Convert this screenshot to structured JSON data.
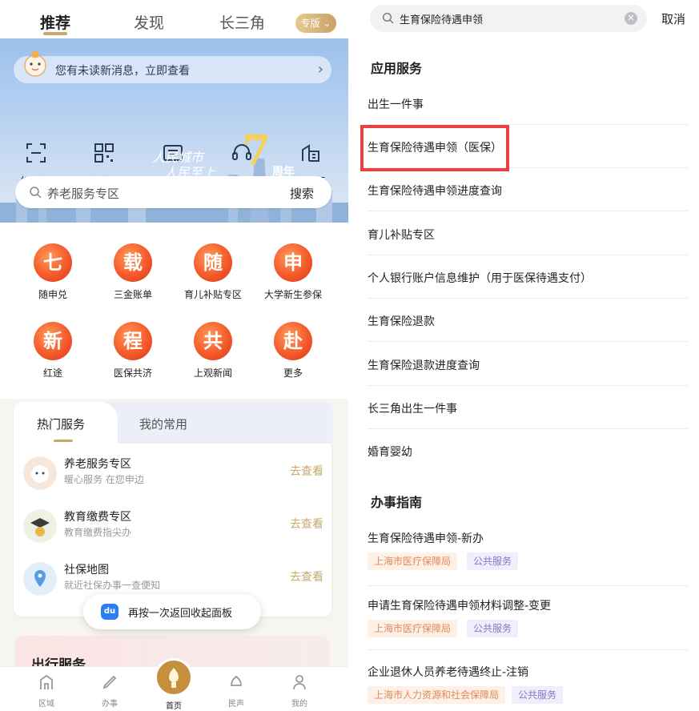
{
  "left": {
    "top_tabs": [
      {
        "label": "推荐",
        "active": true
      },
      {
        "label": "发现",
        "active": false
      },
      {
        "label": "长三角",
        "active": false
      }
    ],
    "edition_label": "专版",
    "notice": {
      "text": "您有未读新消息，立即查看"
    },
    "quick_actions": [
      {
        "label": "扫一扫",
        "icon": "scan-icon"
      },
      {
        "label": "随申码",
        "icon": "qr-code-icon"
      },
      {
        "label": "亮证",
        "icon": "id-card-icon"
      },
      {
        "label": "客服",
        "icon": "customer-service-icon"
      },
      {
        "label": "企业云",
        "icon": "enterprise-cloud-icon"
      }
    ],
    "slogan": [
      "人民城市",
      "人民至上"
    ],
    "anniversary": {
      "digit": "7",
      "label": "周年"
    },
    "search": {
      "placeholder": "养老服务专区",
      "button": "搜索"
    },
    "grid": [
      {
        "char": "七",
        "label": "随申兑"
      },
      {
        "char": "载",
        "label": "三金账单"
      },
      {
        "char": "随",
        "label": "育儿补贴专区"
      },
      {
        "char": "申",
        "label": "大学新生参保"
      },
      {
        "char": "新",
        "label": "红途"
      },
      {
        "char": "程",
        "label": "医保共济"
      },
      {
        "char": "共",
        "label": "上观新闻"
      },
      {
        "char": "赴",
        "label": "更多"
      }
    ],
    "services_card": {
      "tabs": [
        {
          "label": "热门服务",
          "active": true
        },
        {
          "label": "我的常用",
          "active": false
        }
      ],
      "rows": [
        {
          "title": "养老服务专区",
          "subtitle": "暖心服务 在您申边",
          "link": "去查看"
        },
        {
          "title": "教育缴费专区",
          "subtitle": "教育缴费指尖办",
          "link": "去查看"
        },
        {
          "title": "社保地图",
          "subtitle": "就近社保办事一查便知",
          "link": "去查看"
        }
      ]
    },
    "toast": {
      "logo": "du",
      "text": "再按一次返回收起面板"
    },
    "travel_title": "出行服务",
    "tabbar": [
      {
        "label": "区域",
        "icon": "district-icon"
      },
      {
        "label": "办事",
        "icon": "pen-icon"
      },
      {
        "label": "首页",
        "icon": "home-icon",
        "active": true
      },
      {
        "label": "民声",
        "icon": "voice-icon"
      },
      {
        "label": "我的",
        "icon": "profile-icon"
      }
    ]
  },
  "right": {
    "search": {
      "query": "生育保险待遇申领",
      "cancel": "取消"
    },
    "app_section_title": "应用服务",
    "app_items": [
      "出生一件事",
      "生育保险待遇申领（医保）",
      "生育保险待遇申领进度查询",
      "育儿补贴专区",
      "个人银行账户信息维护（用于医保待遇支付）",
      "生育保险退款",
      "生育保险退款进度查询",
      "长三角出生一件事",
      "婚育婴幼"
    ],
    "guide_section_title": "办事指南",
    "guide_items": [
      {
        "title": "生育保险待遇申领-新办",
        "tags": [
          "上海市医疗保障局",
          "公共服务"
        ]
      },
      {
        "title": "申请生育保险待遇申领材料调整-变更",
        "tags": [
          "上海市医疗保障局",
          "公共服务"
        ]
      },
      {
        "title": "企业退休人员养老待遇终止-注销",
        "tags": [
          "上海市人力资源和社会保障局",
          "公共服务"
        ]
      }
    ]
  }
}
